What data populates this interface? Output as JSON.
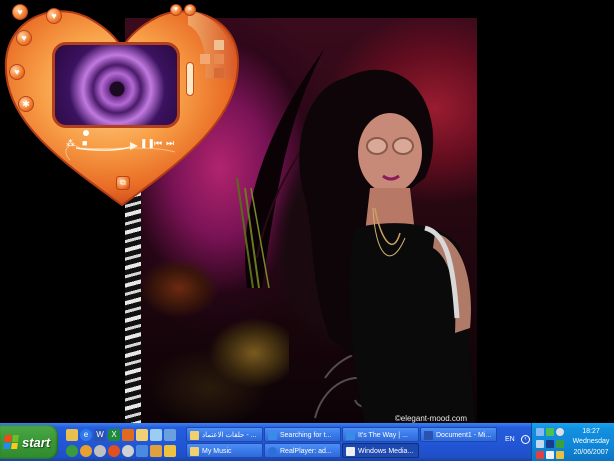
{
  "wallpaper": {
    "watermark": "©elegant-mood.com"
  },
  "media_player": {
    "skin": "heart-shaped orange skin",
    "icons": [
      "heart-icon",
      "heart-icon",
      "heart-icon",
      "heart-icon",
      "star-icon"
    ]
  },
  "taskbar": {
    "start_label": "start",
    "quick_launch": [
      "show-desktop-icon",
      "internet-explorer-icon",
      "word-icon",
      "excel-icon",
      "paint-icon",
      "windows-explorer-icon",
      "notepad-icon",
      "media-player-icon",
      "messenger-icon",
      "outlook-icon",
      "realplayer-icon",
      "firefox-icon",
      "winamp-icon",
      "volume-icon"
    ],
    "tasks_row1": [
      {
        "label": "حلقات الاعتماد - ...",
        "icon": "folder-icon",
        "active": false
      },
      {
        "label": "Searching for t...",
        "icon": "ie-icon",
        "active": false
      },
      {
        "label": "It's The Way | ...",
        "icon": "ie-icon",
        "active": false
      },
      {
        "label": "Document1 - Mi...",
        "icon": "word-icon",
        "active": false
      }
    ],
    "tasks_row2": [
      {
        "label": "My Music",
        "icon": "folder-icon",
        "active": false
      },
      {
        "label": "RealPlayer: ad...",
        "icon": "realplayer-icon",
        "active": false
      },
      {
        "label": "Windows Media...",
        "icon": "media-player-icon",
        "active": true
      }
    ],
    "language": "EN",
    "clock": {
      "time": "18:27",
      "day": "Wednesday",
      "date": "20/06/2007"
    }
  },
  "colors": {
    "taskbar_blue": "#245edc",
    "start_green": "#3c9a38",
    "tray_blue": "#0f86d8",
    "player_orange": "#f07a2c"
  }
}
